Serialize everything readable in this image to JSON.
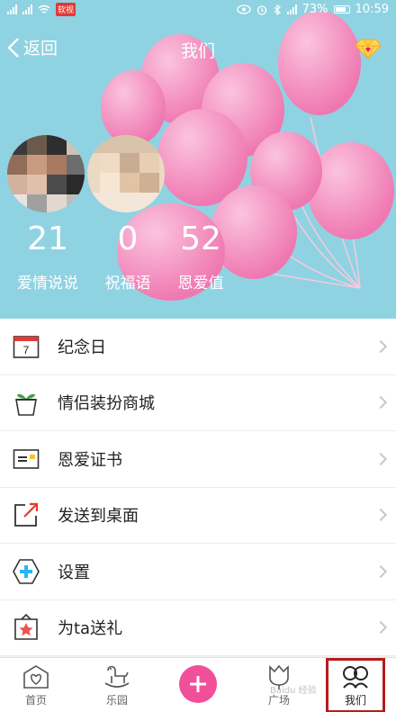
{
  "status_bar": {
    "app_badge": "软视",
    "battery": "73%",
    "time": "10:59"
  },
  "nav": {
    "back_label": "返回",
    "title": "我们"
  },
  "stats": [
    {
      "value": "21",
      "label": "爱情说说"
    },
    {
      "value": "0",
      "label": "祝福语"
    },
    {
      "value": "52",
      "label": "恩爱值"
    }
  ],
  "menu": [
    {
      "label": "纪念日",
      "icon": "calendar-icon"
    },
    {
      "label": "情侣装扮商城",
      "icon": "plant-pot-icon"
    },
    {
      "label": "恩爱证书",
      "icon": "certificate-icon"
    },
    {
      "label": "发送到桌面",
      "icon": "send-to-desktop-icon"
    },
    {
      "label": "设置",
      "icon": "settings-hexagon-icon"
    },
    {
      "label": "为ta送礼",
      "icon": "gift-icon"
    }
  ],
  "calendar_day": "7",
  "tabs": {
    "home": "首页",
    "park": "乐园",
    "plaza": "广场",
    "us": "我们"
  },
  "watermark": "Baidu 经验",
  "colors": {
    "hero_bg": "#8fd3e2",
    "balloon": "#f48fbf",
    "accent": "#f14f9a",
    "highlight_border": "#b71c1c"
  }
}
